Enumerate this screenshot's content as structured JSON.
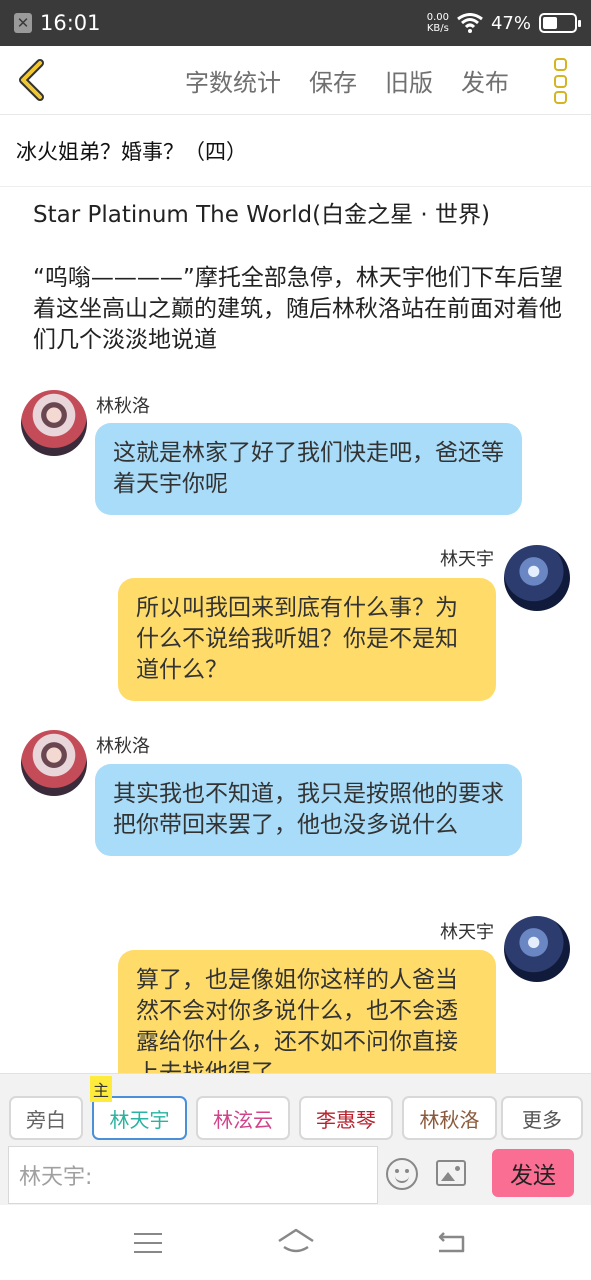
{
  "status": {
    "time": "16:01",
    "speed_value": "0.00",
    "speed_unit": "KB/s",
    "battery": "47%",
    "battery_level": 0.47
  },
  "toolbar": {
    "word_count": "字数统计",
    "save": "保存",
    "old_version": "旧版",
    "publish": "发布"
  },
  "chapter": {
    "title": "冰火姐弟？婚事？（四）"
  },
  "content": {
    "heading": "Star Platinum The World(白金之星 · 世界)",
    "narration": "“呜嗡————”摩托全部急停，林天宇他们下车后望着这坐高山之巅的建筑，随后林秋洛站在前面对着他们几个淡淡地说道",
    "messages": [
      {
        "speaker": "林秋洛",
        "text": "这就是林家了好了我们快走吧，爸还等着天宇你呢"
      },
      {
        "speaker": "林天宇",
        "text": "所以叫我回来到底有什么事？为什么不说给我听姐？你是不是知道什么？"
      },
      {
        "speaker": "林秋洛",
        "text": "其实我也不知道，我只是按照他的要求把你带回来罢了，他也没多说什么"
      },
      {
        "speaker": "林天宇",
        "text": "算了，也是像姐你这样的人爸当然不会对你多说什么，也不会透露给你什么，还不如不问你直接上去找他得了"
      }
    ]
  },
  "characters": {
    "narrator": "旁白",
    "main_tag": "主",
    "items": [
      {
        "label": "林天宇",
        "color": "#2ab3a0"
      },
      {
        "label": "林泫云",
        "color": "#d2438a"
      },
      {
        "label": "李惠琴",
        "color": "#b8232f"
      },
      {
        "label": "林秋洛",
        "color": "#8b5a3c"
      }
    ],
    "more": "更多"
  },
  "composer": {
    "placeholder": "林天宇:",
    "send": "发送"
  }
}
